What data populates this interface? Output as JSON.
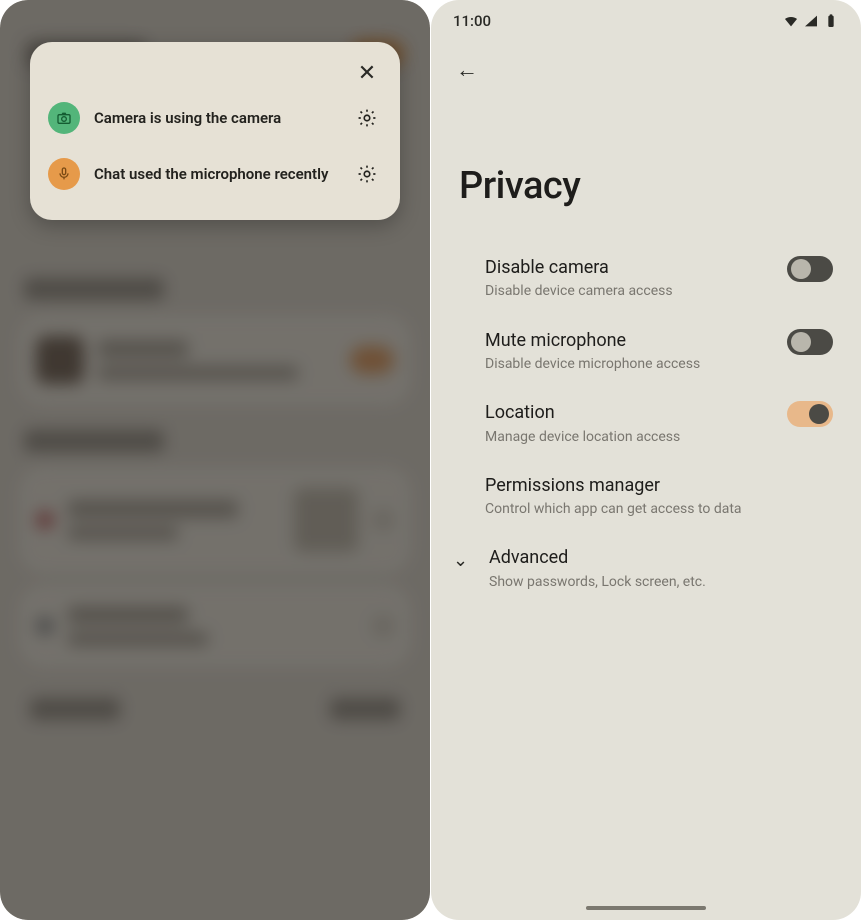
{
  "left": {
    "popup": {
      "camera_text": "Camera is using the camera",
      "mic_text": "Chat used the microphone recently"
    }
  },
  "right": {
    "status_time": "11:00",
    "title": "Privacy",
    "items": {
      "camera": {
        "title": "Disable camera",
        "sub": "Disable device camera access"
      },
      "mic": {
        "title": "Mute microphone",
        "sub": "Disable device microphone access"
      },
      "location": {
        "title": "Location",
        "sub": "Manage device location access"
      },
      "perms": {
        "title": "Permissions manager",
        "sub": "Control which app can get access to data"
      },
      "advanced": {
        "title": "Advanced",
        "sub": "Show passwords, Lock screen, etc."
      }
    }
  }
}
